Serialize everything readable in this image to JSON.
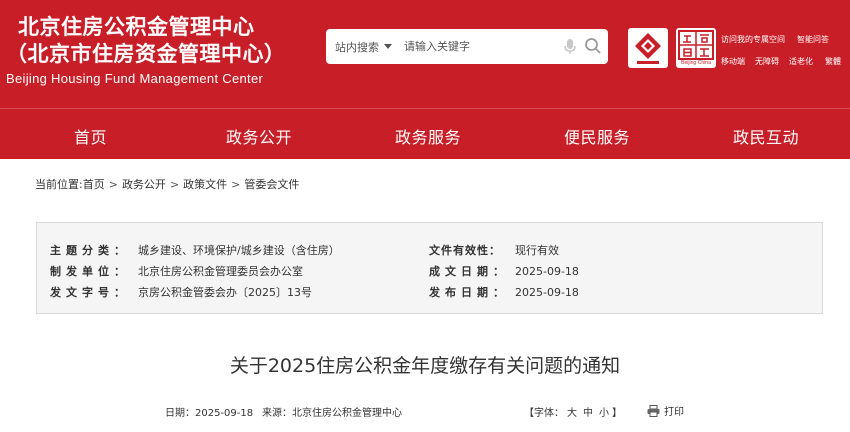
{
  "header": {
    "title_cn_line1": "北京住房公积金管理中心",
    "title_cn_line2": "（北京市住房资金管理中心）",
    "title_en": "Beijing Housing Fund Management Center",
    "search": {
      "scope": "站内搜索",
      "placeholder": "请输入关键字"
    },
    "logo2_text": "Beijing·China",
    "toplinks": [
      "访问我的专属空间",
      "智能问答",
      "移动端",
      "无障碍",
      "适老化",
      "繁體"
    ]
  },
  "nav": [
    "首页",
    "政务公开",
    "政务服务",
    "便民服务",
    "政民互动"
  ],
  "breadcrumb": {
    "prefix": "当前位置:",
    "items": [
      "首页",
      "政务公开",
      "政策文件",
      "管委会文件"
    ]
  },
  "meta": {
    "topic_label": "主题分类：",
    "topic_value": "城乡建设、环境保护/城乡建设（含住房）",
    "validity_label": "文件有效性：",
    "validity_value": "现行有效",
    "issuer_label": "制发单位：",
    "issuer_value": "北京住房公积金管理委员会办公室",
    "written_label": "成文日期：",
    "written_value": "2025-09-18",
    "docno_label": "发文字号：",
    "docno_value": "京房公积金管委会办〔2025〕13号",
    "published_label": "发布日期：",
    "published_value": "2025-09-18"
  },
  "document": {
    "title": "关于2025住房公积金年度缴存有关问题的通知",
    "date_label": "日期：",
    "date": "2025-09-18",
    "source_label": "来源：",
    "source": "北京住房公积金管理中心",
    "font_label": "【字体：",
    "font_large": "大",
    "font_medium": "中",
    "font_small": "小",
    "font_close": "】",
    "print_label": "打印"
  },
  "colors": {
    "brand_red": "#c81e28",
    "meta_bg": "#f5f5f5"
  }
}
